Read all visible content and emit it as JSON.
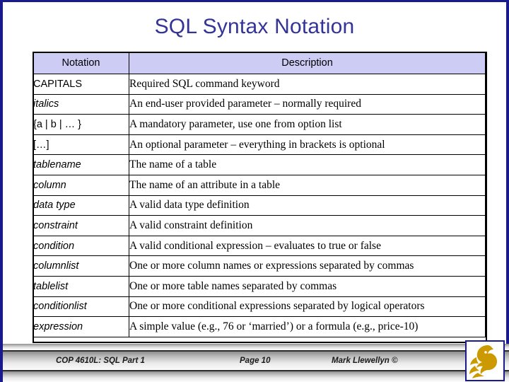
{
  "slide": {
    "title": "SQL Syntax Notation",
    "title_color": "#333399",
    "border_color": "#1a1a8c",
    "header_fill": "#ccccf5"
  },
  "table": {
    "columns": [
      "Notation",
      "Description"
    ],
    "rows": [
      {
        "notation": "CAPITALS",
        "italic": false,
        "description": "Required SQL command keyword"
      },
      {
        "notation": "italics",
        "italic": true,
        "description": "An end-user provided parameter – normally required"
      },
      {
        "notation": "{a | b | … }",
        "italic": false,
        "description": "A mandatory parameter, use one from option list"
      },
      {
        "notation": "[…]",
        "italic": false,
        "description": "An optional parameter – everything in brackets is optional"
      },
      {
        "notation": "tablename",
        "italic": true,
        "description": "The name of a table"
      },
      {
        "notation": "column",
        "italic": true,
        "description": "The name of an attribute in a table"
      },
      {
        "notation": "data type",
        "italic": true,
        "description": "A valid data type definition"
      },
      {
        "notation": "constraint",
        "italic": true,
        "description": "A valid constraint definition"
      },
      {
        "notation": "condition",
        "italic": true,
        "description": "A valid conditional expression – evaluates to true or false"
      },
      {
        "notation": "columnlist",
        "italic": true,
        "description": "One or more column names or expressions separated by commas"
      },
      {
        "notation": "tablelist",
        "italic": true,
        "description": "One or more table names separated by commas"
      },
      {
        "notation": "conditionlist",
        "italic": true,
        "description": "One or more conditional expressions separated by logical operators"
      },
      {
        "notation": "expression",
        "italic": true,
        "description": "A simple value (e.g., 76 or ‘married’) or a formula (e.g., price-10)"
      }
    ]
  },
  "footer": {
    "course": "COP 4610L: SQL Part 1",
    "page": "Page 10",
    "author": "Mark Llewellyn ©",
    "logo_color": "#cc9900"
  }
}
